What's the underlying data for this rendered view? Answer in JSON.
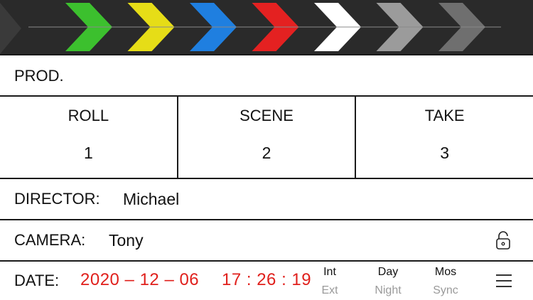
{
  "clapper": {
    "chevrons": [
      "#3cc02e",
      "#e6dd17",
      "#1f7fe0",
      "#e42121",
      "#ffffff",
      "#9b9b9b",
      "#6f6f6f"
    ]
  },
  "prod": {
    "label": "PROD."
  },
  "slate": [
    {
      "label": "ROLL",
      "value": "1"
    },
    {
      "label": "SCENE",
      "value": "2"
    },
    {
      "label": "TAKE",
      "value": "3"
    }
  ],
  "director": {
    "label": "DIRECTOR:",
    "value": "Michael"
  },
  "camera": {
    "label": "CAMERA:",
    "value": "Tony",
    "lock_icon": "lock-icon"
  },
  "date": {
    "label": "DATE:",
    "date_value": "2020 – 12 – 06",
    "time_value": "17 : 26 : 19",
    "int_label": "Int",
    "ext_label": "Ext",
    "day_label": "Day",
    "night_label": "Night",
    "mos_label": "Mos",
    "sync_label": "Sync",
    "menu_icon": "menu-icon",
    "accent_color": "#e0201c"
  }
}
